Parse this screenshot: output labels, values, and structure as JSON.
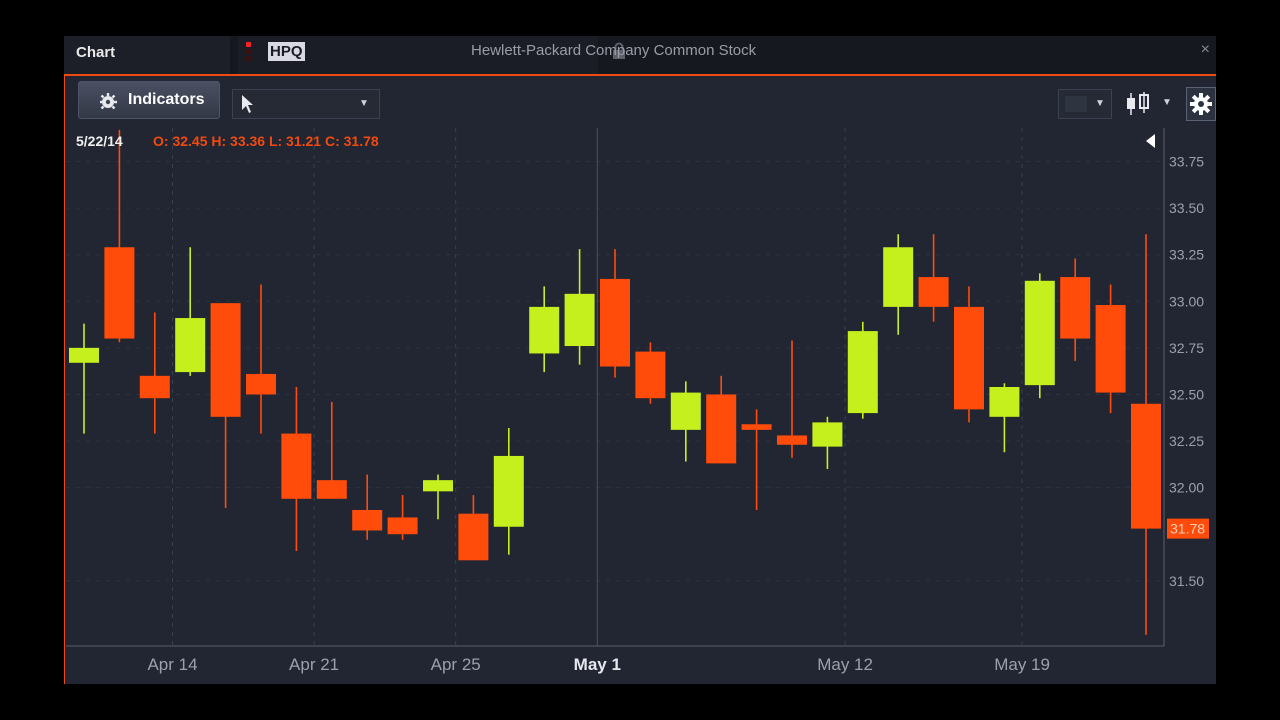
{
  "window": {
    "title": "Chart",
    "symbol": "HPQ",
    "company_name": "Hewlett-Packard Company Common Stock",
    "close_label": "×"
  },
  "toolbar": {
    "indicators_label": "Indicators",
    "cursor_icon": "pointer-arrow-icon",
    "settings_icon": "gear-icon",
    "chart_type_icon": "candlestick-icon"
  },
  "ohlc_readout": {
    "date": "5/22/14",
    "text": "O: 32.45 H: 33.36 L: 31.21 C: 31.78"
  },
  "colors": {
    "up": "#c5f01e",
    "down": "#ff4c0a",
    "accent": "#f04a10",
    "background": "#222632"
  },
  "chart_data": {
    "type": "candlestick",
    "title": "",
    "xlabel": "",
    "ylabel": "",
    "ylim": [
      31.15,
      33.93
    ],
    "y_ticks": [
      "33.75",
      "33.50",
      "33.25",
      "33.00",
      "32.75",
      "32.50",
      "32.25",
      "32.00",
      "31.50"
    ],
    "y_tick_values": [
      33.75,
      33.5,
      33.25,
      33.0,
      32.75,
      32.5,
      32.25,
      32.0,
      31.5
    ],
    "x_labels": [
      {
        "label": "Apr 14",
        "index": 2.5,
        "bold": false
      },
      {
        "label": "Apr 21",
        "index": 6.5,
        "bold": false
      },
      {
        "label": "Apr 25",
        "index": 10.5,
        "bold": false
      },
      {
        "label": "May 1",
        "index": 14.5,
        "bold": true
      },
      {
        "label": "May 12",
        "index": 21.5,
        "bold": false
      },
      {
        "label": "May 19",
        "index": 26.5,
        "bold": false
      }
    ],
    "last_price": "31.78",
    "series": [
      {
        "candles": [
          {
            "o": 32.67,
            "h": 32.88,
            "l": 32.29,
            "c": 32.75
          },
          {
            "o": 33.29,
            "h": 33.92,
            "l": 32.78,
            "c": 32.8
          },
          {
            "o": 32.6,
            "h": 32.94,
            "l": 32.29,
            "c": 32.48
          },
          {
            "o": 32.62,
            "h": 33.29,
            "l": 32.6,
            "c": 32.91
          },
          {
            "o": 32.99,
            "h": 32.99,
            "l": 31.89,
            "c": 32.38
          },
          {
            "o": 32.61,
            "h": 33.09,
            "l": 32.29,
            "c": 32.5
          },
          {
            "o": 32.29,
            "h": 32.54,
            "l": 31.66,
            "c": 31.94
          },
          {
            "o": 32.04,
            "h": 32.46,
            "l": 31.94,
            "c": 31.94
          },
          {
            "o": 31.88,
            "h": 32.07,
            "l": 31.72,
            "c": 31.77
          },
          {
            "o": 31.84,
            "h": 31.96,
            "l": 31.72,
            "c": 31.75
          },
          {
            "o": 31.98,
            "h": 32.07,
            "l": 31.83,
            "c": 32.04
          },
          {
            "o": 31.86,
            "h": 31.96,
            "l": 31.65,
            "c": 31.61
          },
          {
            "o": 31.79,
            "h": 32.32,
            "l": 31.64,
            "c": 32.17
          },
          {
            "o": 32.72,
            "h": 33.08,
            "l": 32.62,
            "c": 32.97
          },
          {
            "o": 32.76,
            "h": 33.28,
            "l": 32.66,
            "c": 33.04
          },
          {
            "o": 33.12,
            "h": 33.28,
            "l": 32.59,
            "c": 32.65
          },
          {
            "o": 32.73,
            "h": 32.78,
            "l": 32.45,
            "c": 32.48
          },
          {
            "o": 32.31,
            "h": 32.57,
            "l": 32.14,
            "c": 32.51
          },
          {
            "o": 32.5,
            "h": 32.6,
            "l": 32.13,
            "c": 32.13
          },
          {
            "o": 32.34,
            "h": 32.42,
            "l": 31.88,
            "c": 32.31
          },
          {
            "o": 32.28,
            "h": 32.79,
            "l": 32.16,
            "c": 32.23
          },
          {
            "o": 32.22,
            "h": 32.38,
            "l": 32.1,
            "c": 32.35
          },
          {
            "o": 32.4,
            "h": 32.89,
            "l": 32.37,
            "c": 32.84
          },
          {
            "o": 32.97,
            "h": 33.36,
            "l": 32.82,
            "c": 33.29
          },
          {
            "o": 33.13,
            "h": 33.36,
            "l": 32.89,
            "c": 32.97
          },
          {
            "o": 32.97,
            "h": 33.08,
            "l": 32.35,
            "c": 32.42
          },
          {
            "o": 32.38,
            "h": 32.56,
            "l": 32.19,
            "c": 32.54
          },
          {
            "o": 32.55,
            "h": 33.15,
            "l": 32.48,
            "c": 33.11
          },
          {
            "o": 33.13,
            "h": 33.23,
            "l": 32.68,
            "c": 32.8
          },
          {
            "o": 32.98,
            "h": 33.09,
            "l": 32.4,
            "c": 32.51
          },
          {
            "o": 32.45,
            "h": 33.36,
            "l": 31.21,
            "c": 31.78
          }
        ]
      }
    ],
    "grid": true
  }
}
